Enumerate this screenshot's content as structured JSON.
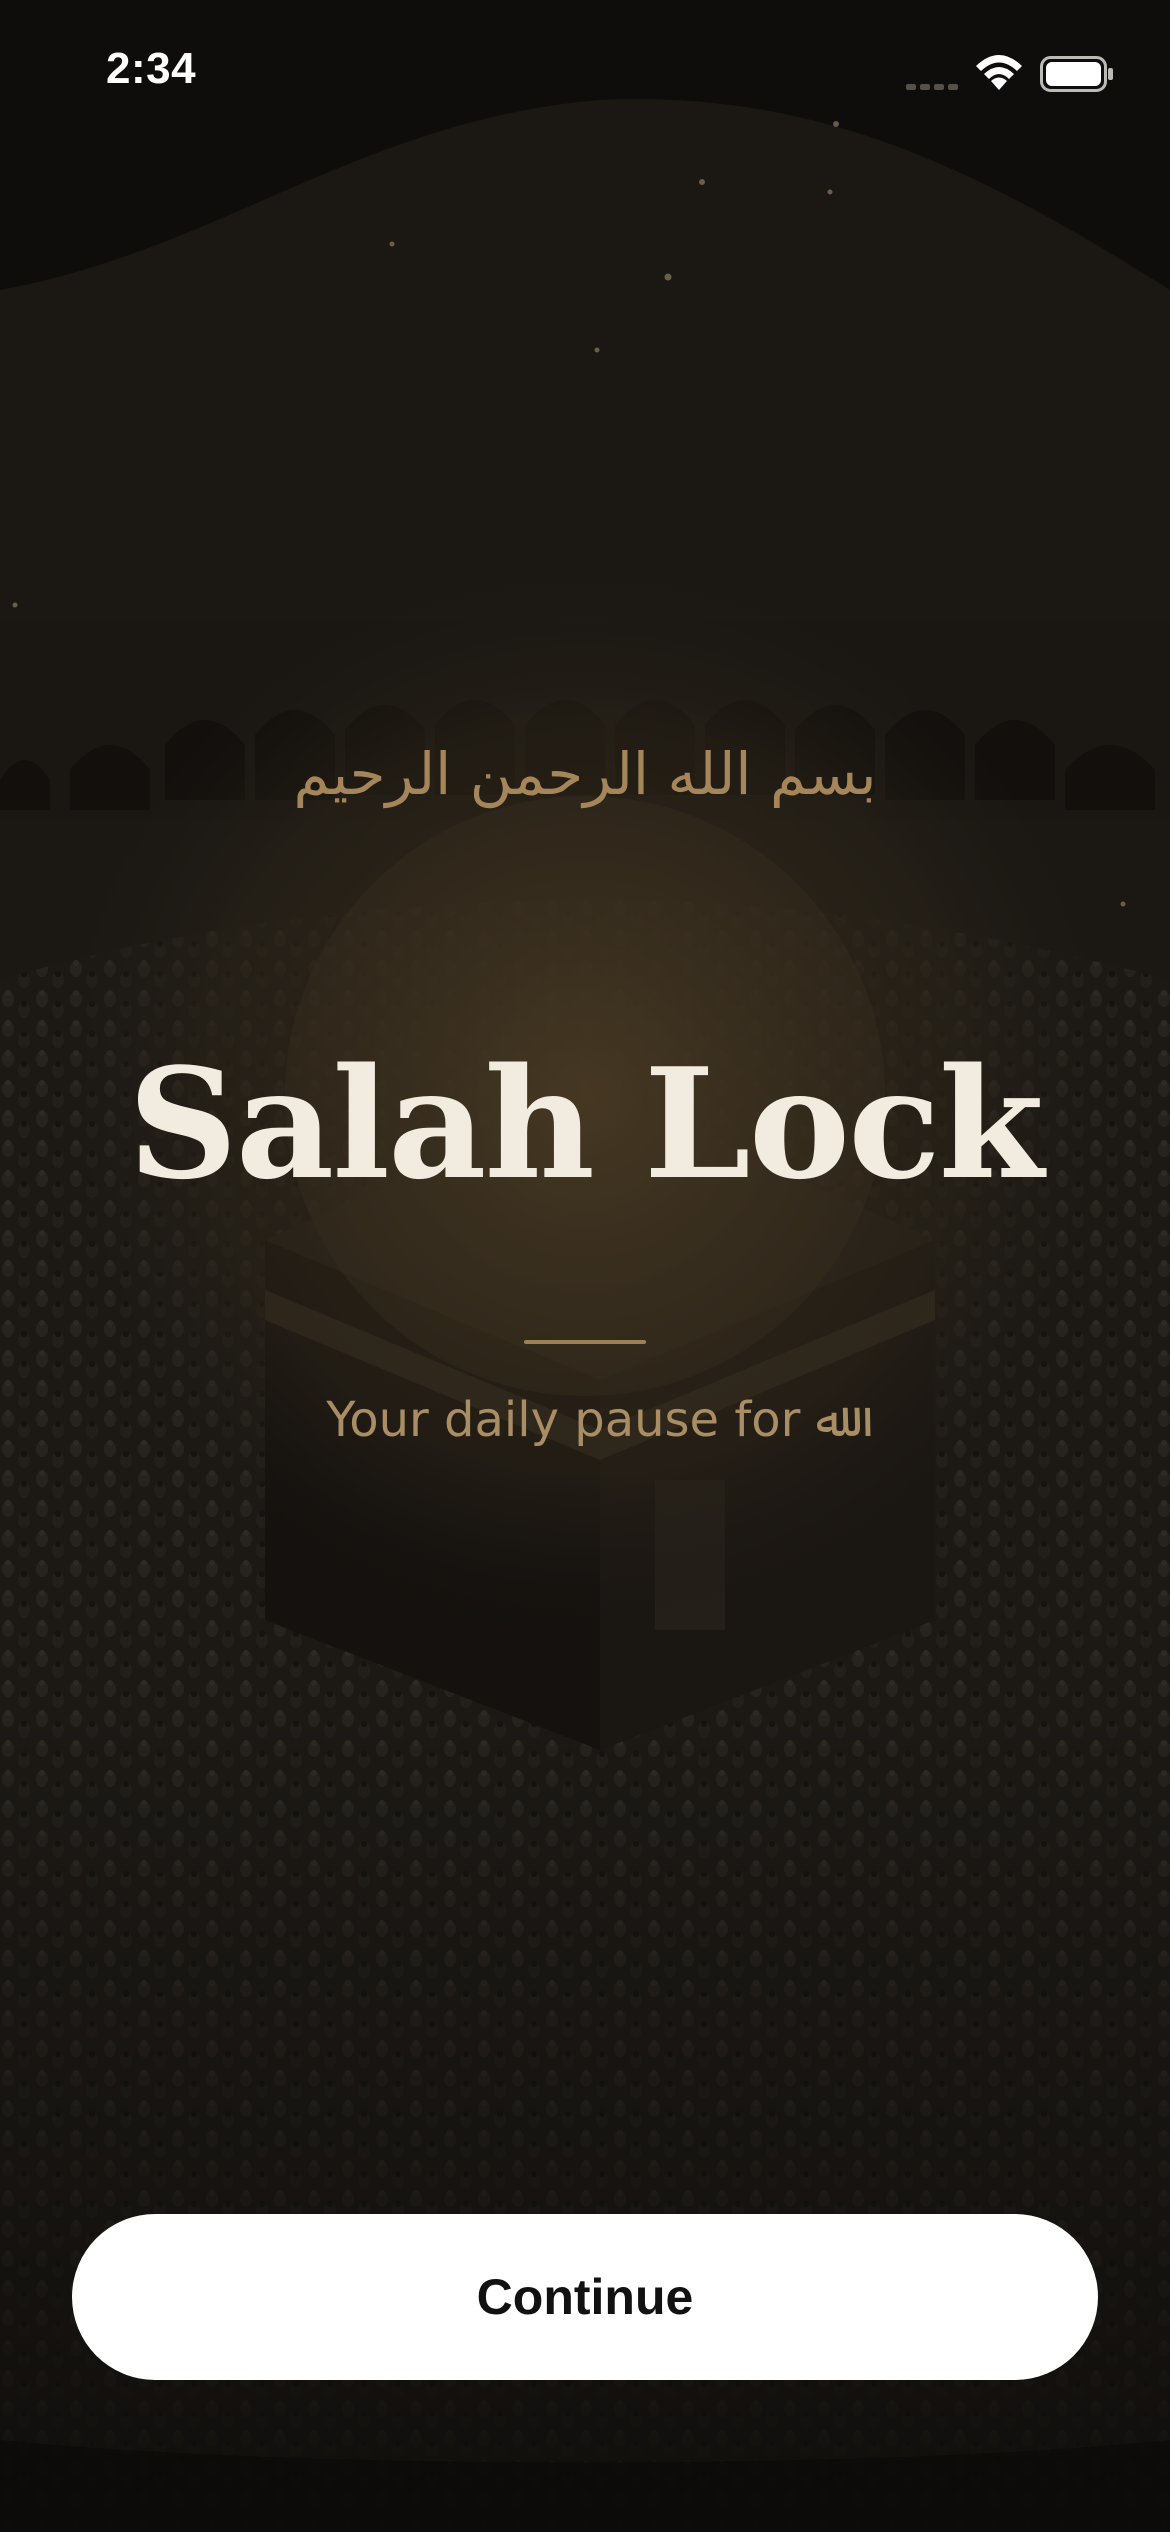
{
  "status_bar": {
    "time": "2:34",
    "icons": [
      "signal-icon",
      "wifi-icon",
      "battery-icon"
    ]
  },
  "bismillah": "بسم الله الرحمن الرحيم",
  "title": "Salah Lock",
  "tagline": "Your daily pause for ﷲ",
  "continue_label": "Continue",
  "colors": {
    "background": "#0f0d0b",
    "accent_gold": "#a5865a",
    "title": "#f1ebe0",
    "button_bg": "#ffffff",
    "button_text": "#111111"
  }
}
